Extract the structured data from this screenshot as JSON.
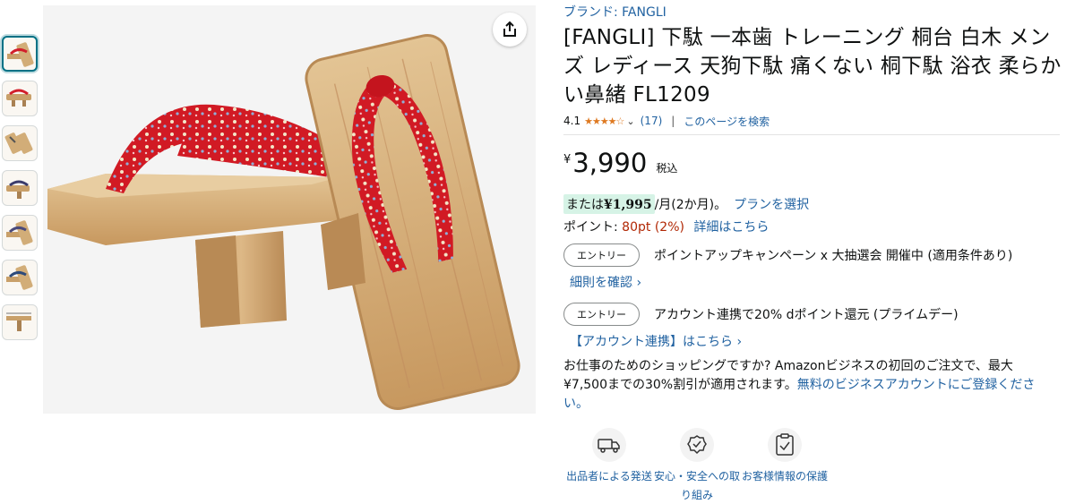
{
  "gallery": {
    "thumbnail_count": 7,
    "active_index": 0
  },
  "product": {
    "brand_label": "ブランド: FANGLI",
    "title": "[FANGLI] 下駄 一本歯 トレーニング 桐台 白木 メンズ レディース 天狗下駄 痛くない 桐下駄 浴衣 柔らかい鼻緒 FL1209",
    "rating_value": "4.1",
    "rating_stars": "★★★★☆",
    "review_count": "(17)",
    "search_page_link": "このページを検索"
  },
  "price": {
    "currency_symbol": "¥",
    "amount": "3,990",
    "tax_label": "税込"
  },
  "installment": {
    "prefix": "または",
    "amount": "¥1,995",
    "suffix": "/月(2か月)。",
    "plan_link": "プランを選択"
  },
  "points": {
    "label": "ポイント: ",
    "value": "80pt",
    "percent": "(2%)",
    "details_link": "詳細はこちら"
  },
  "campaigns": [
    {
      "button_label": "エントリー",
      "text": "ポイントアップキャンペーン x 大抽選会 開催中 (適用条件あり)",
      "link": "細則を確認 ›"
    },
    {
      "button_label": "エントリー",
      "text": "アカウント連携で20% dポイント還元 (プライムデー)",
      "link": "【アカウント連携】はこちら ›"
    }
  ],
  "business": {
    "text": "お仕事のためのショッピングですか? Amazonビジネスの初回のご注文で、最大¥7,500までの30%割引が適用されます。",
    "link": "無料のビジネスアカウントにご登録ください。"
  },
  "features": [
    {
      "icon": "truck-icon",
      "label": "出品者による発送"
    },
    {
      "icon": "badge-check-icon",
      "label": "安心・安全への取り組み"
    },
    {
      "icon": "clipboard-check-icon",
      "label": "お客様情報の保護"
    }
  ],
  "colors": {
    "link": "#2162a1",
    "star": "#de7921",
    "points_red": "#b12704",
    "install_badge_bg": "#d6f3e6",
    "thumb_active": "#007185"
  }
}
